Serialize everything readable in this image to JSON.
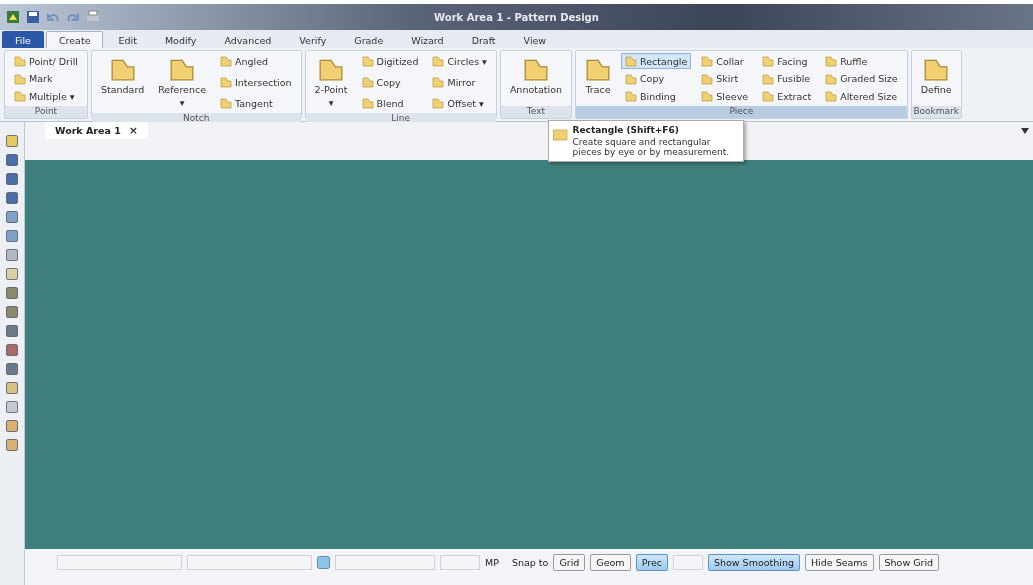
{
  "window": {
    "title": "Work Area 1 - Pattern Design"
  },
  "tabs": [
    {
      "label": "File",
      "selected": false,
      "kind": "file"
    },
    {
      "label": "Create",
      "selected": true,
      "kind": "tab"
    },
    {
      "label": "Edit",
      "selected": false,
      "kind": "tab"
    },
    {
      "label": "Modify",
      "selected": false,
      "kind": "tab"
    },
    {
      "label": "Advanced",
      "selected": false,
      "kind": "tab"
    },
    {
      "label": "Verify",
      "selected": false,
      "kind": "tab"
    },
    {
      "label": "Grade",
      "selected": false,
      "kind": "tab"
    },
    {
      "label": "Wizard",
      "selected": false,
      "kind": "tab"
    },
    {
      "label": "Draft",
      "selected": false,
      "kind": "tab"
    },
    {
      "label": "View",
      "selected": false,
      "kind": "tab"
    }
  ],
  "ribbon": {
    "groups": [
      {
        "label": "Point",
        "active": false,
        "columns": [
          [
            {
              "label": "Point/ Drill",
              "kind": "small",
              "selected": false
            },
            {
              "label": "Mark",
              "kind": "small",
              "selected": false
            },
            {
              "label": "Multiple ▾",
              "kind": "small",
              "selected": false
            }
          ]
        ]
      },
      {
        "label": "Notch",
        "active": false,
        "columns": [
          [
            {
              "label": "Standard",
              "kind": "large",
              "selected": false
            }
          ],
          [
            {
              "label": "Reference",
              "kind": "large",
              "dropdown": "▾",
              "selected": false
            }
          ],
          [
            {
              "label": "Angled",
              "kind": "small",
              "selected": false
            },
            {
              "label": "Intersection",
              "kind": "small",
              "selected": false
            },
            {
              "label": "Tangent",
              "kind": "small",
              "selected": false
            }
          ]
        ]
      },
      {
        "label": "Line",
        "active": false,
        "columns": [
          [
            {
              "label": "2-Point",
              "kind": "large",
              "dropdown": "▾",
              "selected": false
            }
          ],
          [
            {
              "label": "Digitized",
              "kind": "small",
              "selected": false
            },
            {
              "label": "Copy",
              "kind": "small",
              "selected": false
            },
            {
              "label": "Blend",
              "kind": "small",
              "selected": false
            }
          ],
          [
            {
              "label": "Circles ▾",
              "kind": "small",
              "selected": false
            },
            {
              "label": "Mirror",
              "kind": "small",
              "selected": false
            },
            {
              "label": "Offset ▾",
              "kind": "small",
              "selected": false
            }
          ]
        ]
      },
      {
        "label": "Text",
        "active": false,
        "columns": [
          [
            {
              "label": "Annotation",
              "kind": "large",
              "selected": false
            }
          ]
        ]
      },
      {
        "label": "Piece",
        "active": true,
        "columns": [
          [
            {
              "label": "Trace",
              "kind": "large",
              "selected": false
            }
          ],
          [
            {
              "label": "Rectangle",
              "kind": "small",
              "selected": true
            },
            {
              "label": "Copy",
              "kind": "small",
              "selected": false
            },
            {
              "label": "Binding",
              "kind": "small",
              "selected": false
            }
          ],
          [
            {
              "label": "Collar",
              "kind": "small",
              "selected": false
            },
            {
              "label": "Skirt",
              "kind": "small",
              "selected": false
            },
            {
              "label": "Sleeve",
              "kind": "small",
              "selected": false
            }
          ],
          [
            {
              "label": "Facing",
              "kind": "small",
              "selected": false
            },
            {
              "label": "Fusible",
              "kind": "small",
              "selected": false
            },
            {
              "label": "Extract",
              "kind": "small",
              "selected": false
            }
          ],
          [
            {
              "label": "Ruffle",
              "kind": "small",
              "selected": false
            },
            {
              "label": "Graded Size",
              "kind": "small",
              "selected": false
            },
            {
              "label": "Altered Size",
              "kind": "small",
              "selected": false
            }
          ]
        ]
      },
      {
        "label": "Bookmark",
        "active": false,
        "columns": [
          [
            {
              "label": "Define",
              "kind": "large",
              "selected": false
            }
          ]
        ]
      }
    ]
  },
  "document_tabs": [
    {
      "label": "Work Area 1",
      "close": "×",
      "selected": true
    }
  ],
  "tooltip": {
    "title": "Rectangle (Shift+F6)",
    "body": "Create square and rectangular pieces by eye or by measurement."
  },
  "status_bar": {
    "mp": "MP",
    "snap_label": "Snap to",
    "snap_buttons": [
      {
        "label": "Grid",
        "selected": false
      },
      {
        "label": "Geom",
        "selected": false
      },
      {
        "label": "Prec",
        "selected": true
      }
    ],
    "toggles": [
      {
        "label": "Show Smoothing",
        "selected": true
      },
      {
        "label": "Hide Seams",
        "selected": false
      },
      {
        "label": "Show Grid",
        "selected": false
      }
    ]
  }
}
